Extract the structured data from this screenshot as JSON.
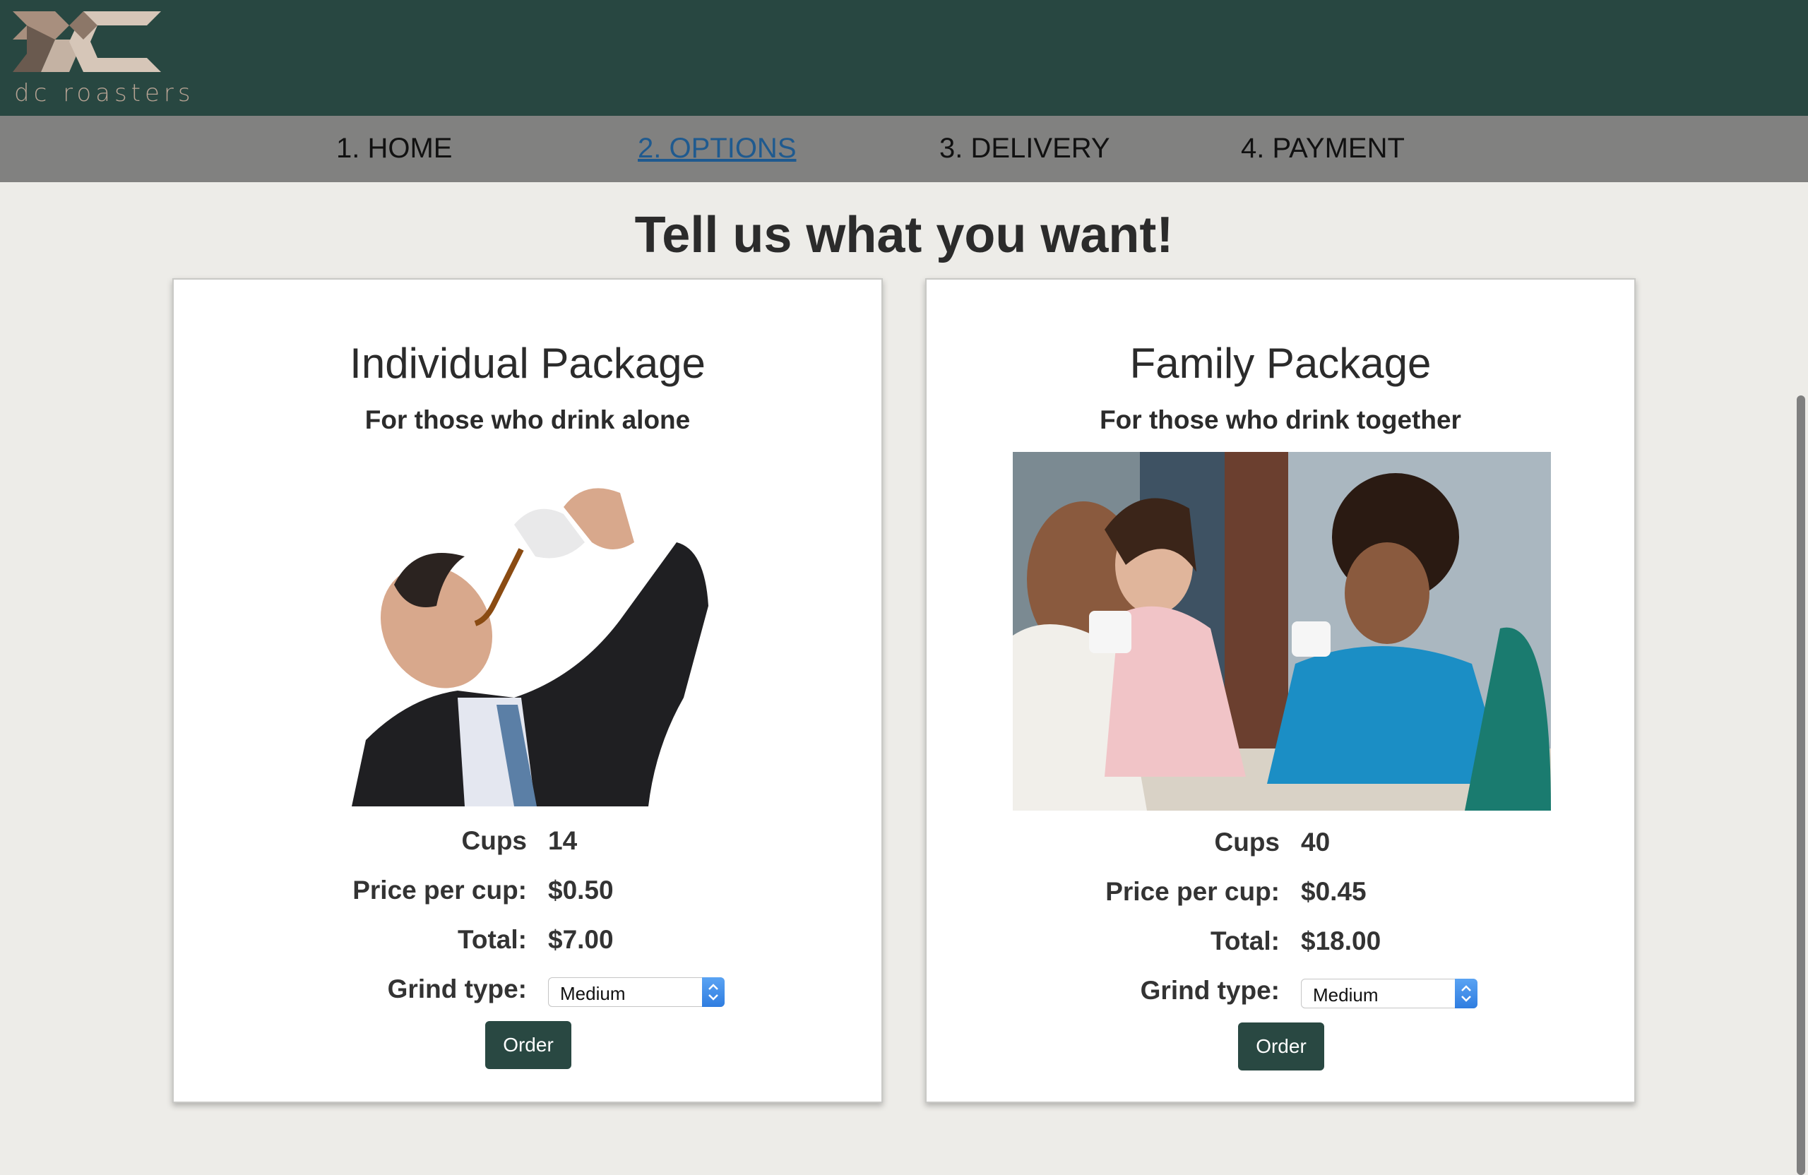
{
  "brand": {
    "name": "dc roasters",
    "logo_icon": "dc-logo-icon"
  },
  "nav": {
    "items": [
      {
        "label": "1. HOME"
      },
      {
        "label": "2. OPTIONS"
      },
      {
        "label": "3. DELIVERY"
      },
      {
        "label": "4. PAYMENT"
      }
    ],
    "active_index": 1
  },
  "headline": "Tell us what you want!",
  "packages": [
    {
      "title": "Individual Package",
      "subtitle": "For those who drink alone",
      "image": "man-pouring-coffee-into-mouth-photo",
      "cups_label": "Cups",
      "cups": "14",
      "price_label": "Price per cup:",
      "price": "$0.50",
      "total_label": "Total:",
      "total": "$7.00",
      "grind_label": "Grind type:",
      "grind_value": "Medium",
      "order_label": "Order"
    },
    {
      "title": "Family Package",
      "subtitle": "For those who drink together",
      "image": "friends-drinking-coffee-photo",
      "cups_label": "Cups",
      "cups": "40",
      "price_label": "Price per cup:",
      "price": "$0.45",
      "total_label": "Total:",
      "total": "$18.00",
      "grind_label": "Grind type:",
      "grind_value": "Medium",
      "order_label": "Order"
    }
  ],
  "colors": {
    "header_bg": "#284741",
    "nav_bg": "#818180",
    "page_bg": "#edece8",
    "active_link": "#1f5a8f",
    "button_bg": "#294842",
    "logo": "#b7a394"
  }
}
